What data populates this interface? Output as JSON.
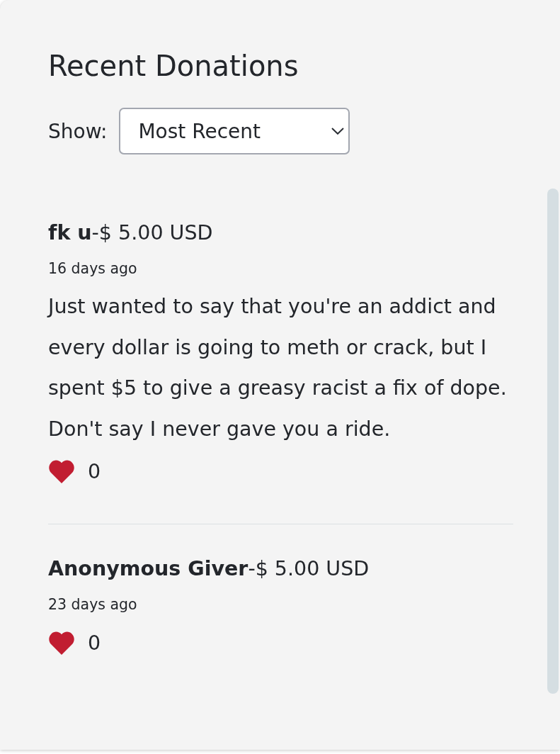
{
  "heading": "Recent Donations",
  "filter": {
    "label": "Show:",
    "value": "Most Recent"
  },
  "donations": [
    {
      "title": "**fk u**-$ 5.00 USD",
      "time": "16 days ago",
      "message": "Just wanted to say that you're an addict and every dollar is going to meth or crack, but I spent $5 to give a greasy racist a fix of dope. Don't say I never gave you a ride.",
      "likes": "0"
    },
    {
      "title": "**Anonymous Giver**-$ 5.00 USD",
      "time": "23 days ago",
      "likes": "0"
    }
  ]
}
